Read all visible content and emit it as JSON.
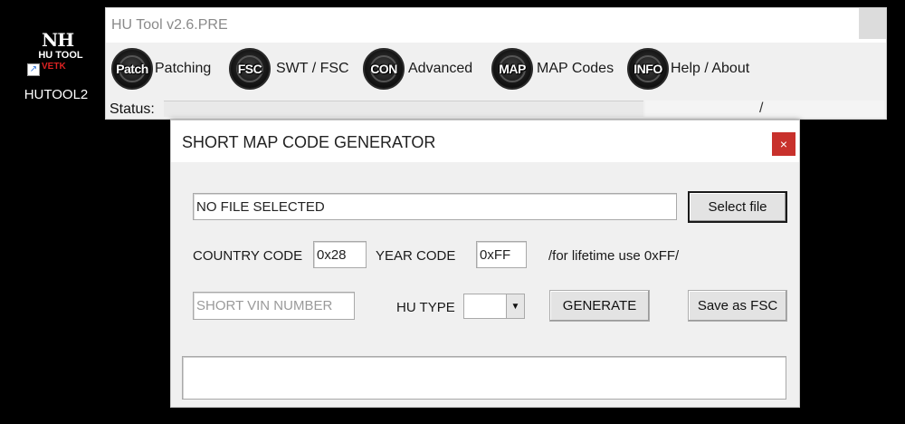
{
  "desktop": {
    "logo_text": "NH",
    "logo_sub": "HU TOOL",
    "logo_red": "VETK",
    "icon_label": "HUTOOL2"
  },
  "main_window": {
    "title": "HU Tool v2.6.PRE",
    "toolbar": [
      {
        "icon_text": "Patch",
        "label": "Patching",
        "icon": "patch-icon"
      },
      {
        "icon_text": "FSC",
        "label": "SWT / FSC",
        "icon": "fsc-icon"
      },
      {
        "icon_text": "CON",
        "label": "Advanced",
        "icon": "con-icon"
      },
      {
        "icon_text": "MAP",
        "label": "MAP Codes",
        "icon": "map-icon"
      },
      {
        "icon_text": "INFO",
        "label": "Help / About",
        "icon": "info-icon"
      }
    ],
    "status_label": "Status:",
    "status_value": "",
    "status_extra": "/"
  },
  "dialog": {
    "title": "SHORT MAP CODE GENERATOR",
    "close_glyph": "×",
    "file_field_value": "NO FILE SELECTED",
    "select_file_label": "Select file",
    "country_code_label": "COUNTRY CODE",
    "country_code_value": "0x28",
    "year_code_label": "YEAR CODE",
    "year_code_value": "0xFF",
    "year_hint": "/for lifetime use 0xFF/",
    "vin_placeholder": "SHORT VIN NUMBER",
    "hu_type_label": "HU TYPE",
    "hu_type_value": "",
    "generate_label": "GENERATE",
    "save_fsc_label": "Save as FSC",
    "output_value": ""
  }
}
